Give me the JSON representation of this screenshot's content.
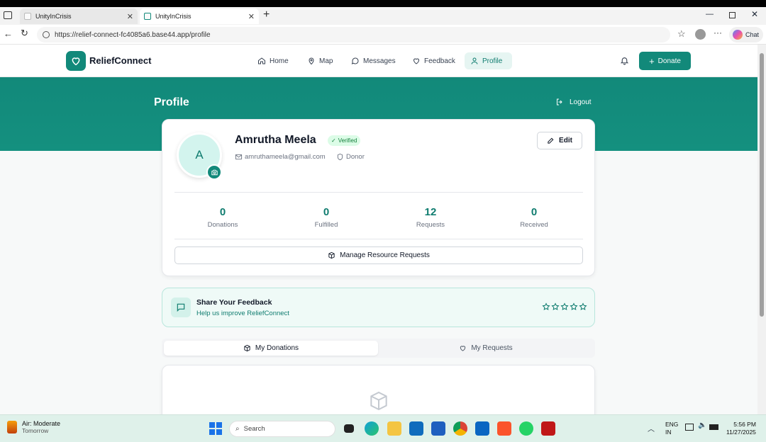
{
  "browser": {
    "tabs": [
      {
        "title": "UnityInCrisis",
        "active": false
      },
      {
        "title": "UnityInCrisis",
        "active": true
      }
    ],
    "url": "https://relief-connect-fc4085a6.base44.app/profile",
    "chat_label": "Chat"
  },
  "nav": {
    "brand": "ReliefConnect",
    "items": [
      {
        "label": "Home",
        "icon": "home-icon"
      },
      {
        "label": "Map",
        "icon": "map-pin-icon"
      },
      {
        "label": "Messages",
        "icon": "message-icon"
      },
      {
        "label": "Feedback",
        "icon": "heart-icon"
      },
      {
        "label": "Profile",
        "icon": "user-icon",
        "active": true
      }
    ],
    "donate_label": "Donate"
  },
  "hero": {
    "title": "Profile",
    "logout_label": "Logout"
  },
  "profile": {
    "avatar_initial": "A",
    "name": "Amrutha Meela",
    "verified_label": "Verified",
    "email": "amruthameela@gmail.com",
    "role": "Donor",
    "edit_label": "Edit",
    "stats": [
      {
        "value": "0",
        "label": "Donations"
      },
      {
        "value": "0",
        "label": "Fulfilled"
      },
      {
        "value": "12",
        "label": "Requests"
      },
      {
        "value": "0",
        "label": "Received"
      }
    ],
    "manage_label": "Manage Resource Requests"
  },
  "feedback": {
    "title": "Share Your Feedback",
    "subtitle": "Help us improve ReliefConnect",
    "stars": 5
  },
  "tabs": {
    "my_donations": "My Donations",
    "my_requests": "My Requests"
  },
  "taskbar": {
    "weather_title": "Air: Moderate",
    "weather_sub": "Tomorrow",
    "search_placeholder": "Search",
    "lang1": "ENG",
    "lang2": "IN",
    "time": "5:56 PM",
    "date": "11/27/2025"
  },
  "colors": {
    "accent": "#12897a",
    "accent_light": "#e6f5f2"
  }
}
